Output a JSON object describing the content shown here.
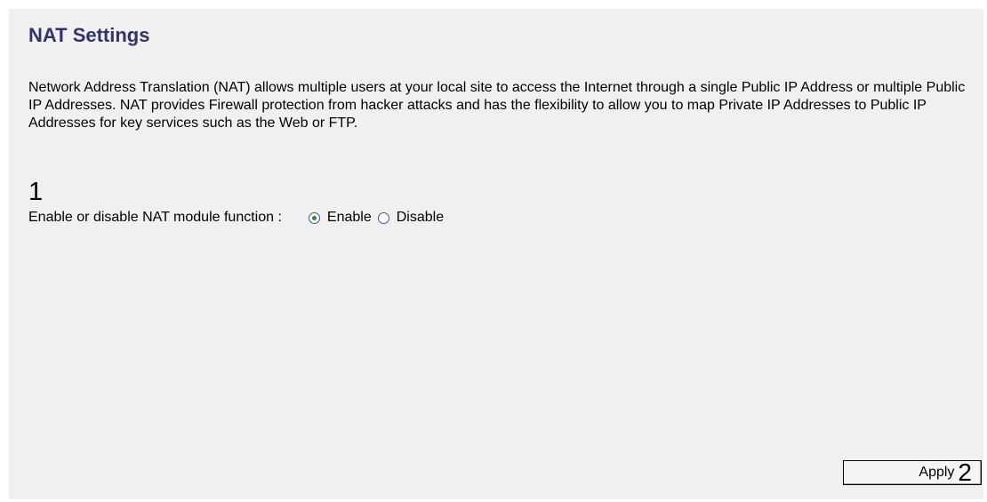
{
  "page": {
    "title": "NAT Settings",
    "description": "Network Address Translation (NAT) allows multiple users at your local site to access the Internet through a single Public IP Address or multiple Public IP Addresses. NAT provides Firewall protection from hacker attacks and has the flexibility to allow you to map Private IP Addresses to Public IP Addresses for key services such as the Web or FTP."
  },
  "markers": {
    "one": "1",
    "two": "2"
  },
  "nat_module": {
    "label": "Enable or disable NAT module function :",
    "selected": "Enable",
    "options": [
      {
        "label": "Enable",
        "checked": true
      },
      {
        "label": "Disable",
        "checked": false
      }
    ]
  },
  "buttons": {
    "apply_label": "Apply"
  },
  "colors": {
    "title": "#33336b",
    "panel_background": "#f0f0f0",
    "radio_dot": "#2e8b2e"
  },
  "icons": {
    "enable_radio": "radio-checked-icon",
    "disable_radio": "radio-unchecked-icon"
  }
}
